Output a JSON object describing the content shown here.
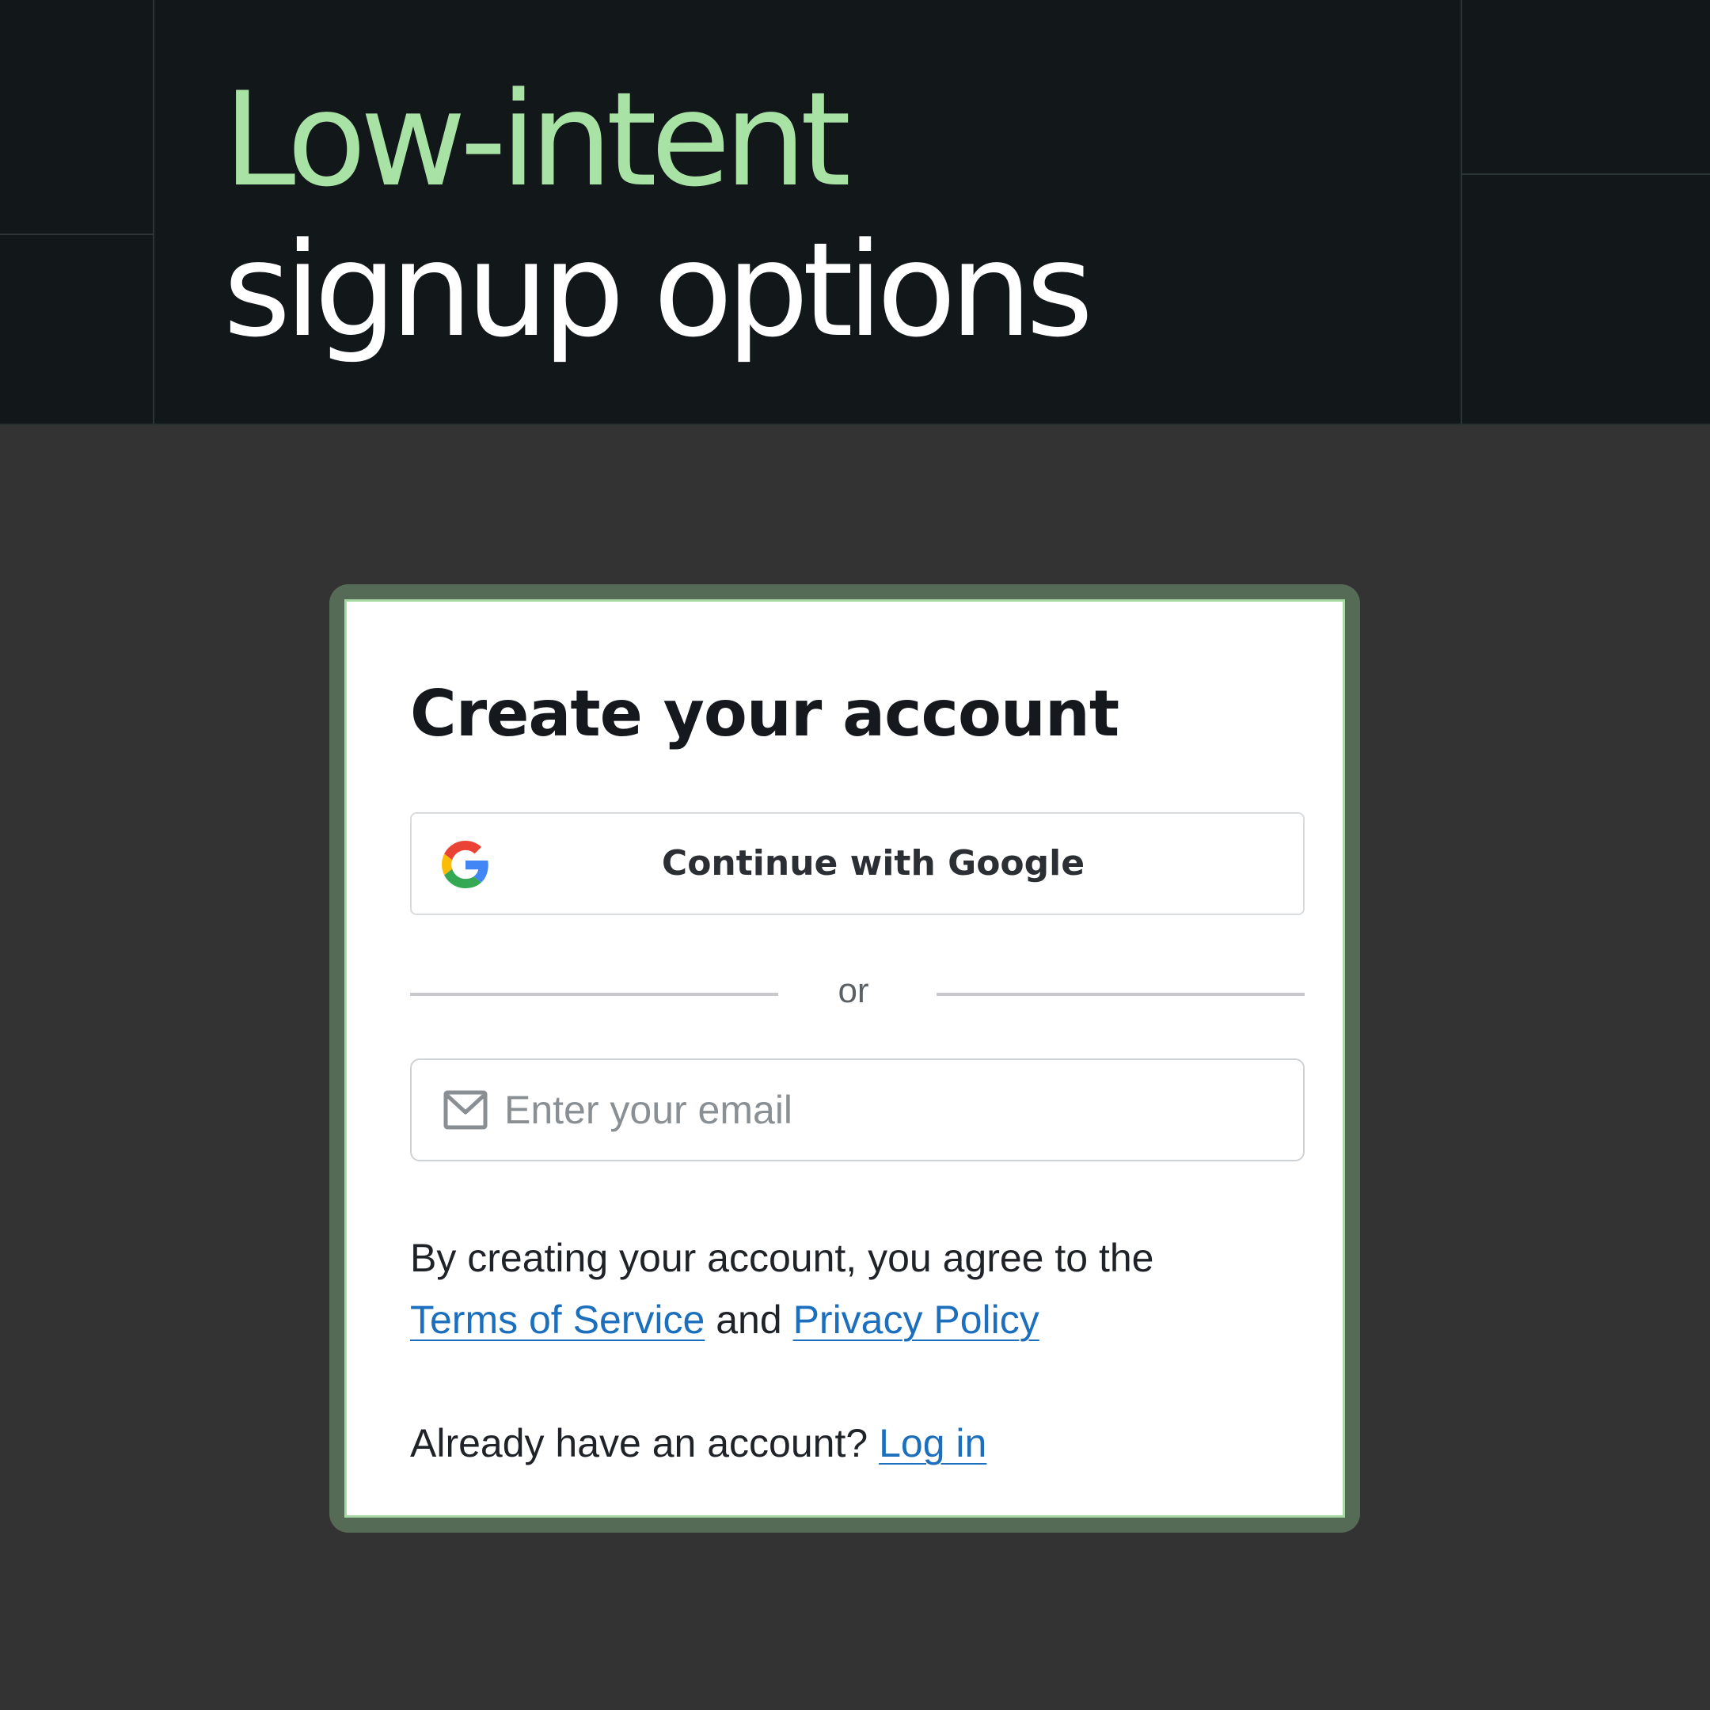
{
  "header": {
    "title_line1": "Low-intent",
    "title_line2": "signup options"
  },
  "signup": {
    "title": "Create your account",
    "google_button_label": "Continue with Google",
    "divider_text": "or",
    "email_placeholder": "Enter your email",
    "terms_prefix": "By creating your account, you agree to the",
    "terms_link": "Terms of Service",
    "terms_and": "and",
    "privacy_link": "Privacy Policy",
    "login_prompt": "Already have an account?",
    "login_link": "Log in"
  },
  "icons": {
    "google": "google-g-icon",
    "mail": "mail-icon"
  },
  "colors": {
    "header_bg": "#12171a",
    "page_bg": "#333333",
    "accent_green": "#a8e2a5",
    "card_border": "#a6d8a4",
    "link_blue": "#1c6fbd"
  }
}
